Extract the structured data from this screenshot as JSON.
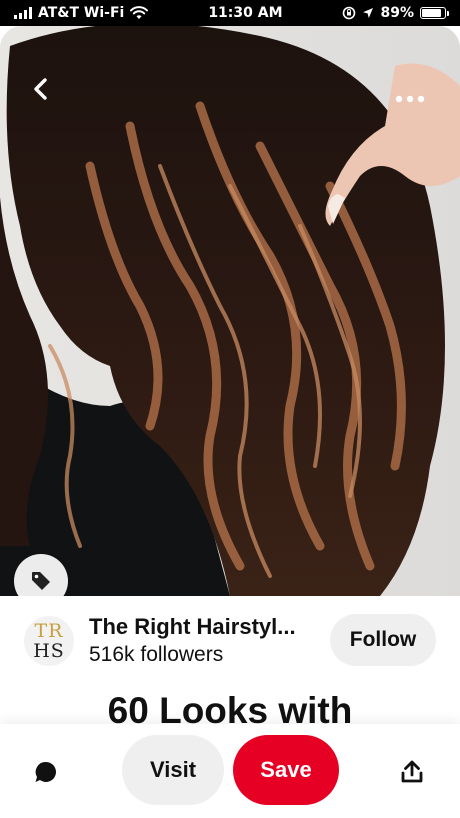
{
  "status_bar": {
    "carrier": "AT&T Wi-Fi",
    "time": "11:30 AM",
    "battery": "89%",
    "battery_level": 0.89,
    "icons": [
      "signal-icon",
      "wifi-icon",
      "screen-rotation-lock-icon",
      "location-arrow-icon",
      "battery-icon"
    ]
  },
  "pin": {
    "image": "hair-photo",
    "nav_icons": [
      "back-arrow-icon",
      "more-options-icon",
      "tag-icon"
    ]
  },
  "creator": {
    "avatar_line1": "TR",
    "avatar_line2": "HS",
    "name": "The Right Hairstyl...",
    "followers": "516k followers",
    "follow_label": "Follow"
  },
  "title": "60 Looks with",
  "action_bar": {
    "visit_label": "Visit",
    "save_label": "Save",
    "icons": [
      "comment-icon",
      "share-icon"
    ]
  },
  "colors": {
    "save_red": "#e60023",
    "button_gray": "#efefef",
    "avatar_gold": "#c6a040"
  }
}
